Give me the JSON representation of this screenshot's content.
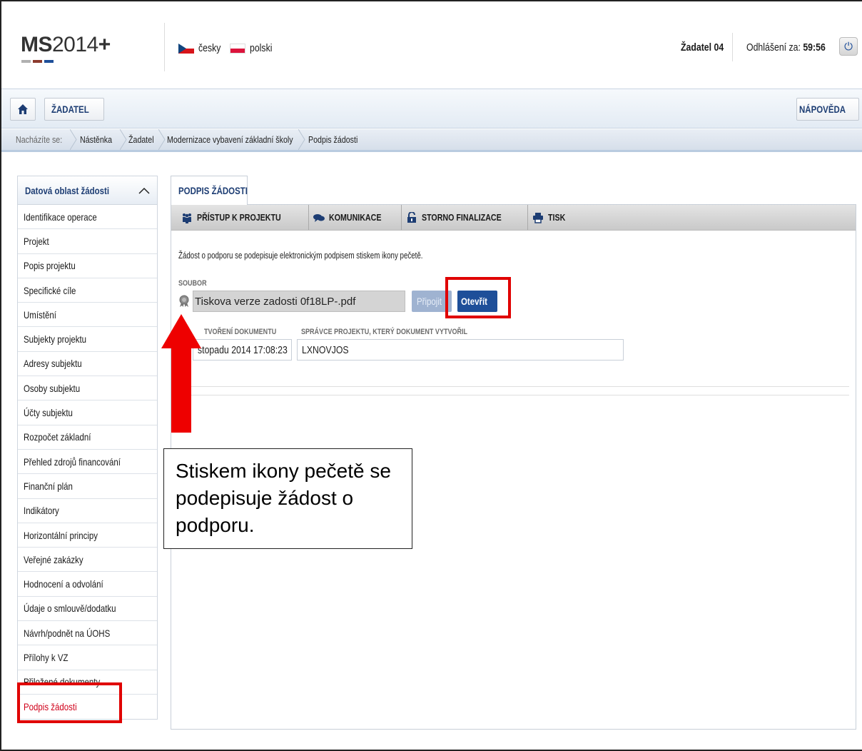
{
  "app": {
    "logo_bold": "MS",
    "logo_rest": "2014",
    "logo_plus": "+",
    "logo_colors": [
      "#b0b0b0",
      "#8c3b2e",
      "#1e4f99"
    ]
  },
  "languages": [
    {
      "label": "česky",
      "flag": "cz-flag"
    },
    {
      "label": "polski",
      "flag": "pl-flag"
    }
  ],
  "user": {
    "name": "Žadatel 04",
    "logout_label": "Odhlášení za:",
    "logout_time": "59:56"
  },
  "nav": {
    "home_icon": "home-icon",
    "zadatel_label": "ŽADATEL",
    "help_label": "NÁPOVĚDA"
  },
  "breadcrumb": {
    "prefix": "Nacházíte se:",
    "items": [
      "Nástěnka",
      "Žadatel",
      "Modernizace vybavení základní školy",
      "Podpis žádosti"
    ]
  },
  "sidebar": {
    "title": "Datová oblast žádosti",
    "items": [
      "Identifikace operace",
      "Projekt",
      "Popis projektu",
      "Specifické cíle",
      "Umístění",
      "Subjekty projektu",
      "Adresy subjektu",
      "Osoby subjektu",
      "Účty subjektu",
      "Rozpočet základní",
      "Přehled zdrojů financování",
      "Finanční plán",
      "Indikátory",
      "Horizontální principy",
      "Veřejné zakázky",
      "Hodnocení a odvolání",
      "Údaje o smlouvě/dodatku",
      "Návrh/podnět na ÚOHS",
      "Přílohy k VZ",
      "Přiložené dokumenty",
      "Podpis žádosti"
    ],
    "active": "Podpis žádosti"
  },
  "main": {
    "tab_label": "PODPIS ŽÁDOSTI",
    "toolbar": [
      {
        "label": "PŘÍSTUP K PROJEKTU",
        "icon": "people-icon"
      },
      {
        "label": "KOMUNIKACE",
        "icon": "chat-icon"
      },
      {
        "label": "STORNO FINALIZACE",
        "icon": "unlock-icon"
      },
      {
        "label": "TISK",
        "icon": "printer-icon"
      }
    ],
    "description": "Žádost o podporu se podepisuje elektronickým podpisem stiskem ikony pečetě.",
    "file_label": "SOUBOR",
    "file_name": "Tiskova verze zadosti 0f18LP-.pdf",
    "attach_label": "Připojit",
    "open_label": "Otevřít",
    "date_label": "TVOŘENÍ DOKUMENTU",
    "date_value": "stopadu 2014 17:08:23",
    "manager_label": "SPRÁVCE PROJEKTU, KTERÝ DOKUMENT VYTVOŘIL",
    "manager_value": "LXNOVJOS"
  },
  "annotation": {
    "callout_text": "Stiskem ikony pečetě se podepisuje žádost o podporu.",
    "highlight_color": "#e00000"
  }
}
